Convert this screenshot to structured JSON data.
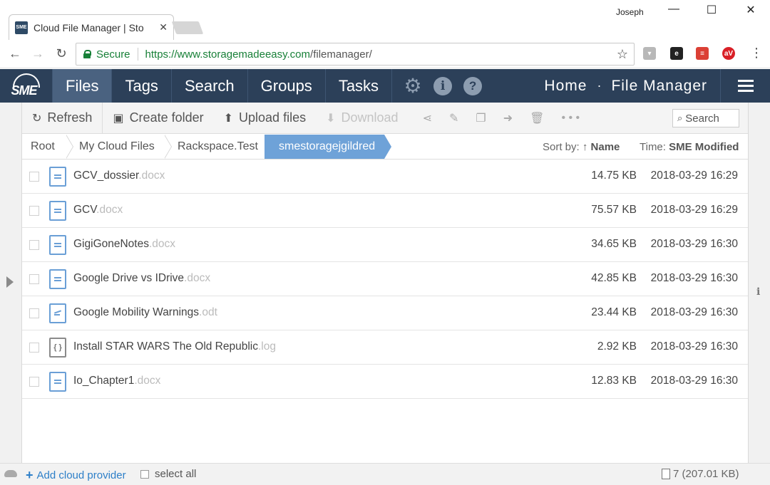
{
  "browser": {
    "tab_title": "Cloud File Manager | Sto",
    "tab_favicon_text": "SME",
    "user_name": "Joseph",
    "secure_label": "Secure",
    "url_host": "https://www.storagemadeeasy.com",
    "url_path": "/filemanager/",
    "extensions": [
      {
        "name": "shield-extension-icon",
        "label": "",
        "color": "#9a9a9a"
      },
      {
        "name": "evernote-extension-icon",
        "label": "",
        "color": "#222222"
      },
      {
        "name": "todoist-extension-icon",
        "label": "",
        "color": "#db4035"
      },
      {
        "name": "av-extension-icon",
        "label": "aV",
        "color": "#d92027"
      }
    ]
  },
  "app_nav": {
    "logo_text": "SME",
    "tabs": [
      {
        "label": "Files",
        "active": true
      },
      {
        "label": "Tags",
        "active": false
      },
      {
        "label": "Search",
        "active": false
      },
      {
        "label": "Groups",
        "active": false
      },
      {
        "label": "Tasks",
        "active": false
      }
    ],
    "breadcrumb_home": "Home",
    "breadcrumb_sep": "·",
    "breadcrumb_current": "File Manager"
  },
  "toolbar": {
    "refresh": "Refresh",
    "create_folder": "Create folder",
    "upload_files": "Upload files",
    "download": "Download",
    "more": "• • •",
    "search_label": "Search"
  },
  "path": {
    "crumbs": [
      "Root",
      "My Cloud Files",
      "Rackspace.Test"
    ],
    "current": "smestoragejgildred",
    "sort_label": "Sort by:",
    "sort_arrow": "↑",
    "sort_value": "Name",
    "time_label": "Time:",
    "time_value": "SME Modified"
  },
  "files": [
    {
      "name": "GCV_dossier",
      "ext": ".docx",
      "size": "14.75 KB",
      "date": "2018-03-29 16:29",
      "icon": "document-icon"
    },
    {
      "name": "GCV",
      "ext": ".docx",
      "size": "75.57 KB",
      "date": "2018-03-29 16:29",
      "icon": "document-icon"
    },
    {
      "name": "GigiGoneNotes",
      "ext": ".docx",
      "size": "34.65 KB",
      "date": "2018-03-29 16:30",
      "icon": "document-icon"
    },
    {
      "name": "Google Drive vs IDrive",
      "ext": ".docx",
      "size": "42.85 KB",
      "date": "2018-03-29 16:30",
      "icon": "document-icon"
    },
    {
      "name": "Google Mobility Warnings",
      "ext": ".odt",
      "size": "23.44 KB",
      "date": "2018-03-29 16:30",
      "icon": "odt-document-icon"
    },
    {
      "name": "Install STAR WARS The Old Republic",
      "ext": ".log",
      "size": "2.92 KB",
      "date": "2018-03-29 16:30",
      "icon": "code-file-icon"
    },
    {
      "name": "Io_Chapter1",
      "ext": ".docx",
      "size": "12.83 KB",
      "date": "2018-03-29 16:30",
      "icon": "document-icon"
    }
  ],
  "footer": {
    "add_provider": "Add cloud provider",
    "select_all": "select all",
    "count": "7 (207.01 KB)"
  }
}
